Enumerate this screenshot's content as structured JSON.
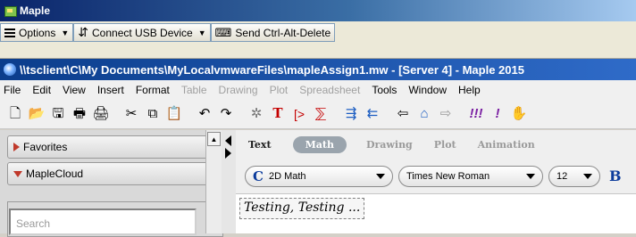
{
  "vm_window": {
    "title": "Maple"
  },
  "vm_toolbar": {
    "options_label": "Options",
    "usb_label": "Connect USB Device",
    "cad_label": "Send Ctrl-Alt-Delete"
  },
  "app_window": {
    "title": "\\\\tsclient\\C\\My Documents\\MyLocalvmwareFiles\\mapleAssign1.mw - [Server 4] - Maple 2015"
  },
  "menubar": {
    "items": [
      "File",
      "Edit",
      "View",
      "Insert",
      "Format",
      "Table",
      "Drawing",
      "Plot",
      "Spreadsheet",
      "Tools",
      "Window",
      "Help"
    ],
    "disabled": [
      "Table",
      "Drawing",
      "Plot",
      "Spreadsheet"
    ]
  },
  "toolbar": {
    "icons": [
      "new-document-icon",
      "open-folder-icon",
      "save-icon",
      "print-icon",
      "print-preview-icon",
      "cut-icon",
      "copy-icon",
      "paste-icon",
      "undo-icon",
      "redo-icon",
      "execution-group-icon",
      "text-icon",
      "prompt-icon",
      "sum-icon",
      "indent-icon",
      "outdent-icon",
      "back-icon",
      "home-icon",
      "forward-icon",
      "execute-all-icon",
      "execute-icon",
      "stop-icon"
    ]
  },
  "palettes": {
    "favorites_label": "Favorites",
    "maplecloud_label": "MapleCloud",
    "search_placeholder": "Search"
  },
  "context_bar": {
    "tabs": [
      "Text",
      "Math",
      "Drawing",
      "Plot",
      "Animation"
    ],
    "selected_tab": "Math",
    "mode_value": "2D Math",
    "font_value": "Times New Roman",
    "size_value": "12",
    "bold_label": "B"
  },
  "document": {
    "content": "Testing, Testing ..."
  },
  "colors": {
    "title_gradient_start": "#0b3d8c",
    "title_gradient_end": "#2f6bc8",
    "palette_triangle": "#c0392b",
    "selected_tab_bg": "#9aa4ad"
  }
}
